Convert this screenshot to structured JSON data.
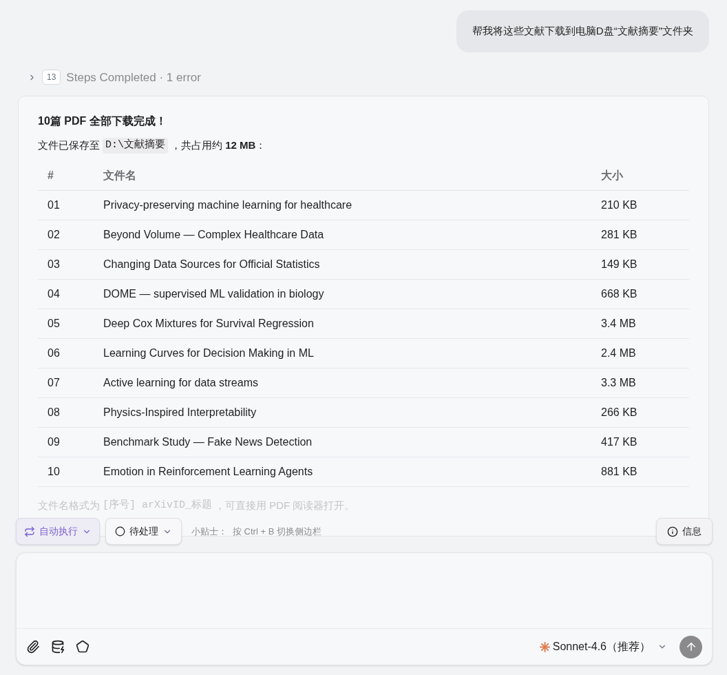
{
  "user_message": "帮我将这些文献下载到电脑D盘“文献摘要\"文件夹",
  "steps": {
    "expanded": false,
    "count": "13",
    "label": "Steps Completed · 1 error"
  },
  "reply": {
    "title": "10篇 PDF 全部下载完成！",
    "saved_prefix": "文件已保存至",
    "path": "D:\\文献摘要",
    "saved_suffix": "，共占用约 **12 MB**：",
    "table": {
      "columns": [
        "#",
        "文件名",
        "大小"
      ],
      "rows": [
        [
          "01",
          "Privacy-preserving machine learning for healthcare",
          "210 KB"
        ],
        [
          "02",
          "Beyond Volume — Complex Healthcare Data",
          "281 KB"
        ],
        [
          "03",
          "Changing Data Sources for Official Statistics",
          "149 KB"
        ],
        [
          "04",
          "DOME — supervised ML validation in biology",
          "668 KB"
        ],
        [
          "05",
          "Deep Cox Mixtures for Survival Regression",
          "3.4 MB"
        ],
        [
          "06",
          "Learning Curves for Decision Making in ML",
          "2.4 MB"
        ],
        [
          "07",
          "Active learning for data streams",
          "3.3 MB"
        ],
        [
          "08",
          "Physics-Inspired Interpretability",
          "266 KB"
        ],
        [
          "09",
          "Benchmark Study — Fake News Detection",
          "417 KB"
        ],
        [
          "10",
          "Emotion in Reinforcement Learning Agents",
          "881 KB"
        ]
      ]
    },
    "note_prefix": "文件名格式为",
    "note_code": "[序号] arXivID_标题",
    "note_suffix": "，可直接用 PDF 阅读器打开。"
  },
  "toolbar": {
    "mode": {
      "label": "自动执行",
      "selected": true
    },
    "status": "待处理",
    "tip_label": "小贴士：",
    "tip": "按 Ctrl + B 切换侧边栏",
    "info": "信息"
  },
  "composer": {
    "model": "Sonnet-4.6（推荐）"
  }
}
